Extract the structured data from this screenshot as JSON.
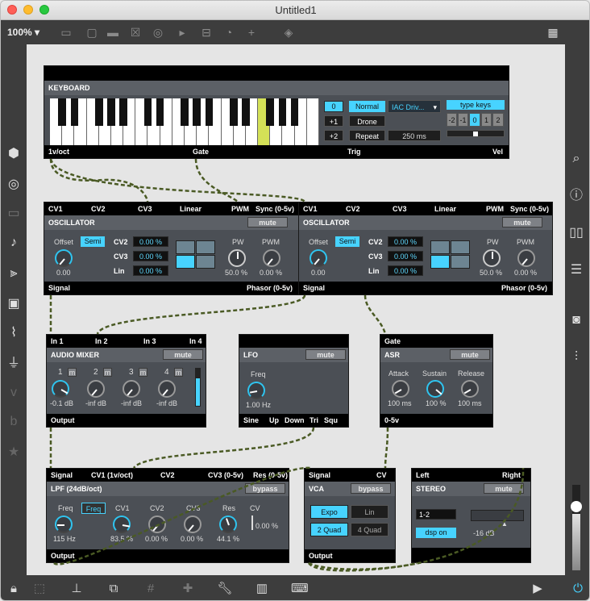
{
  "window": {
    "title": "Untitled1"
  },
  "toolbar": {
    "zoom": "100%"
  },
  "colors": {
    "accent": "#47d3ff",
    "cable": "#4a5a24",
    "module_bg": "#4b4f55"
  },
  "sidebar_left": [
    "packages-icon",
    "target-icon",
    "keyboard-icon",
    "music-note-icon",
    "sequence-icon",
    "image-icon",
    "paperclip-icon",
    "plug-icon",
    "vimeo-icon",
    "b-icon",
    "star-icon"
  ],
  "sidebar_right": [
    "search-icon",
    "info-icon",
    "book-icon",
    "list-icon",
    "camera-icon",
    "mixer-icon"
  ],
  "keyboard": {
    "title": "KEYBOARD",
    "octave_values": [
      "0",
      "+1",
      "+2"
    ],
    "mode_buttons": [
      "Normal",
      "Drone",
      "Repeat"
    ],
    "device": "IAC Driv...",
    "time": "250 ms",
    "type_keys": "type keys",
    "octave_select": [
      "-2",
      "-1",
      "0",
      "1",
      "2"
    ],
    "outputs": [
      "1v/oct",
      "Gate",
      "Trig",
      "Vel"
    ]
  },
  "osc1": {
    "inputs": [
      "CV1",
      "CV2",
      "CV3",
      "Linear",
      "PWM",
      "Sync (0-5v)"
    ],
    "title": "OSCILLATOR",
    "mute": "mute",
    "offset_label": "Offset",
    "semi": "Semi",
    "offset_value": "0.00",
    "cv_labels": [
      "CV2",
      "CV3",
      "Lin"
    ],
    "cv_values": [
      "0.00 %",
      "0.00 %",
      "0.00 %"
    ],
    "pw_label": "PW",
    "pw_value": "50.0 %",
    "pwm_label": "PWM",
    "pwm_value": "0.00 %",
    "outputs": [
      "Signal",
      "Phasor (0-5v)"
    ]
  },
  "osc2": {
    "inputs": [
      "CV1",
      "CV2",
      "CV3",
      "Linear",
      "PWM",
      "Sync (0-5v)"
    ],
    "title": "OSCILLATOR",
    "mute": "mute",
    "offset_label": "Offset",
    "semi": "Semi",
    "offset_value": "0.00",
    "cv_labels": [
      "CV2",
      "CV3",
      "Lin"
    ],
    "cv_values": [
      "0.00 %",
      "0.00 %",
      "0.00 %"
    ],
    "pw_label": "PW",
    "pw_value": "50.0 %",
    "pwm_label": "PWM",
    "pwm_value": "0.00 %",
    "outputs": [
      "Signal",
      "Phasor (0-5v)"
    ]
  },
  "mixer": {
    "inputs": [
      "In 1",
      "In 2",
      "In 3",
      "In 4"
    ],
    "title": "AUDIO MIXER",
    "mute": "mute",
    "channels": [
      "1",
      "2",
      "3",
      "4"
    ],
    "m": "m",
    "values": [
      "-0.1 dB",
      "-inf dB",
      "-inf dB",
      "-inf dB"
    ],
    "output": "Output"
  },
  "lfo": {
    "title": "LFO",
    "mute": "mute",
    "freq_label": "Freq",
    "freq_value": "1.00 Hz",
    "outputs": [
      "Sine",
      "Up",
      "Down",
      "Tri",
      "Squ"
    ]
  },
  "asr": {
    "input": "Gate",
    "title": "ASR",
    "mute": "mute",
    "labels": [
      "Attack",
      "Sustain",
      "Release"
    ],
    "values": [
      "100 ms",
      "100 %",
      "100 ms"
    ],
    "output": "0-5v"
  },
  "lpf": {
    "inputs": [
      "Signal",
      "CV1 (1v/oct)",
      "CV2",
      "CV3 (0-5v)",
      "Res (0-5v)"
    ],
    "title": "LPF (24dB/oct)",
    "bypass": "bypass",
    "freq_label": "Freq",
    "freq_btn": "Freq",
    "freq_value": "115 Hz",
    "knob_labels": [
      "CV1",
      "CV2",
      "CV3",
      "Res",
      "CV"
    ],
    "knob_values": [
      "83.5 %",
      "0.00 %",
      "0.00 %",
      "44.1 %",
      "0.00 %"
    ],
    "output": "Output"
  },
  "vca": {
    "inputs": [
      "Signal",
      "CV"
    ],
    "title": "VCA",
    "bypass": "bypass",
    "modes": [
      "Expo",
      "Lin",
      "2 Quad",
      "4 Quad"
    ],
    "output": "Output"
  },
  "stereo": {
    "inputs": [
      "Left",
      "Right"
    ],
    "title": "STEREO",
    "mute": "mute",
    "channels": "1-2",
    "dsp": "dsp on",
    "level": "-16 dB"
  }
}
